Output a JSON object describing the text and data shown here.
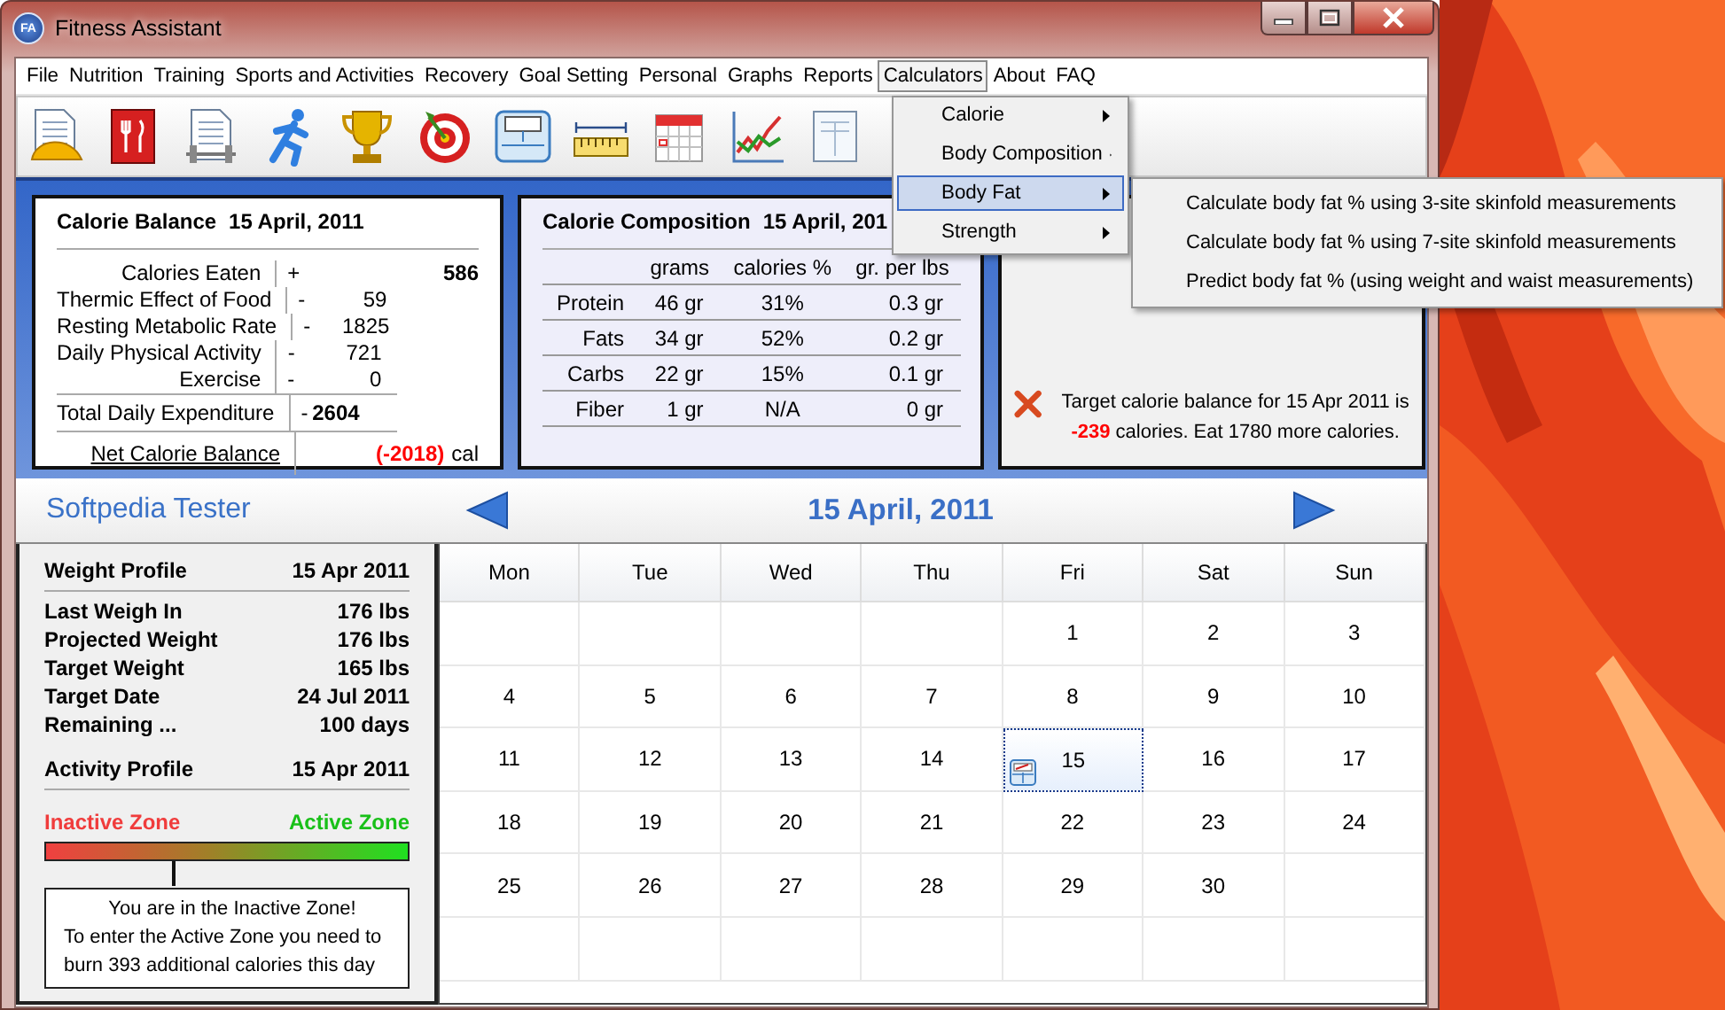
{
  "window": {
    "title": "Fitness Assistant",
    "app_icon": "FA"
  },
  "menu_bar": [
    {
      "label": "File",
      "open": false
    },
    {
      "label": "Nutrition",
      "open": false
    },
    {
      "label": "Training",
      "open": false
    },
    {
      "label": "Sports and Activities",
      "open": false
    },
    {
      "label": "Recovery",
      "open": false
    },
    {
      "label": "Goal Setting",
      "open": false
    },
    {
      "label": "Personal",
      "open": false
    },
    {
      "label": "Graphs",
      "open": false
    },
    {
      "label": "Reports",
      "open": false
    },
    {
      "label": "Calculators",
      "open": true
    },
    {
      "label": "About",
      "open": false
    },
    {
      "label": "FAQ",
      "open": false
    }
  ],
  "calculators_menu": {
    "items": [
      {
        "label": "Calorie",
        "selected": false
      },
      {
        "label": "Body Composition",
        "selected": false
      },
      {
        "label": "Body Fat",
        "selected": true
      },
      {
        "label": "Strength",
        "selected": false
      }
    ],
    "submenu": [
      "Calculate body fat % using 3-site skinfold measurements",
      "Calculate body fat % using 7-site skinfold measurements",
      "Predict body fat % (using weight and waist measurements)"
    ]
  },
  "calorie_balance": {
    "title": "Calorie Balance",
    "date": "15 April, 2011",
    "rows": [
      {
        "kind": "intake",
        "label": "Calories Eaten",
        "sign": "+",
        "value": "586"
      },
      {
        "kind": "expense",
        "label": "Thermic Effect of Food",
        "sign": "-",
        "value": "59"
      },
      {
        "kind": "expense",
        "label": "Resting Metabolic Rate",
        "sign": "-",
        "value": "1825"
      },
      {
        "kind": "expense",
        "label": "Daily Physical Activity",
        "sign": "-",
        "value": "721"
      },
      {
        "kind": "expense",
        "label": "Exercise",
        "sign": "-",
        "value": "0"
      },
      {
        "kind": "total",
        "label": "Total Daily Expenditure",
        "sign": "-",
        "value": "2604"
      }
    ],
    "net": {
      "label": "Net Calorie Balance",
      "value": "(-2018)",
      "unit": "cal"
    }
  },
  "calorie_composition": {
    "title": "Calorie Composition",
    "date": "15 April, 201",
    "columns": [
      "grams",
      "calories %",
      "gr. per lbs"
    ],
    "rows": [
      {
        "name": "Protein",
        "cells": [
          "46 gr",
          "31%",
          "0.3 gr"
        ]
      },
      {
        "name": "Fats",
        "cells": [
          "34 gr",
          "52%",
          "0.2 gr"
        ]
      },
      {
        "name": "Carbs",
        "cells": [
          "22 gr",
          "15%",
          "0.1 gr"
        ]
      },
      {
        "name": "Fiber",
        "cells": [
          "1 gr",
          "N/A",
          "0 gr"
        ]
      }
    ]
  },
  "target": {
    "met": false,
    "message": "Target calorie balance for 15 Apr 2011 is **-239** calories. Eat 1780 more calories."
  },
  "user": {
    "name": "Softpedia Tester"
  },
  "date_nav": {
    "date": "15 April, 2011"
  },
  "profile": {
    "weight_header": {
      "label": "Weight Profile",
      "date": "15 Apr 2011"
    },
    "weight_rows": [
      {
        "label": "Last Weigh In",
        "value": "176 lbs"
      },
      {
        "label": "Projected Weight",
        "value": "176 lbs"
      },
      {
        "label": "Target Weight",
        "value": "165 lbs"
      },
      {
        "label": "Target Date",
        "value": "24 Jul 2011"
      },
      {
        "label": "Remaining ...",
        "value": "100 days"
      }
    ],
    "activity_header": {
      "label": "Activity Profile",
      "date": "15 Apr 2011"
    },
    "zone": {
      "inactive_label": "Inactive Zone",
      "active_label": "Active Zone",
      "level": 0.35,
      "message": [
        "You are in the Inactive Zone!",
        "To enter the Active Zone you need to",
        "burn 393 additional calories this day"
      ]
    }
  },
  "calendar": {
    "weekdays": [
      "Mon",
      "Tue",
      "Wed",
      "Thu",
      "Fri",
      "Sat",
      "Sun"
    ],
    "weeks": [
      {
        "right_aligned": true,
        "days": [
          {
            "label": "1",
            "selected": false,
            "weigh_in": false
          },
          {
            "label": "2",
            "selected": false,
            "weigh_in": false
          },
          {
            "label": "3",
            "selected": false,
            "weigh_in": false
          }
        ]
      },
      {
        "right_aligned": false,
        "days": [
          {
            "label": "4",
            "selected": false,
            "weigh_in": false
          },
          {
            "label": "5",
            "selected": false,
            "weigh_in": false
          },
          {
            "label": "6",
            "selected": false,
            "weigh_in": false
          },
          {
            "label": "7",
            "selected": false,
            "weigh_in": false
          },
          {
            "label": "8",
            "selected": false,
            "weigh_in": false
          },
          {
            "label": "9",
            "selected": false,
            "weigh_in": false
          },
          {
            "label": "10",
            "selected": false,
            "weigh_in": false
          }
        ]
      },
      {
        "right_aligned": false,
        "days": [
          {
            "label": "11",
            "selected": false,
            "weigh_in": false
          },
          {
            "label": "12",
            "selected": false,
            "weigh_in": false
          },
          {
            "label": "13",
            "selected": false,
            "weigh_in": false
          },
          {
            "label": "14",
            "selected": false,
            "weigh_in": false
          },
          {
            "label": "15",
            "selected": true,
            "weigh_in": true
          },
          {
            "label": "16",
            "selected": false,
            "weigh_in": false
          },
          {
            "label": "17",
            "selected": false,
            "weigh_in": false
          }
        ]
      },
      {
        "right_aligned": false,
        "days": [
          {
            "label": "18",
            "selected": false,
            "weigh_in": false
          },
          {
            "label": "19",
            "selected": false,
            "weigh_in": false
          },
          {
            "label": "20",
            "selected": false,
            "weigh_in": false
          },
          {
            "label": "21",
            "selected": false,
            "weigh_in": false
          },
          {
            "label": "22",
            "selected": false,
            "weigh_in": false
          },
          {
            "label": "23",
            "selected": false,
            "weigh_in": false
          },
          {
            "label": "24",
            "selected": false,
            "weigh_in": false
          }
        ]
      },
      {
        "right_aligned": false,
        "days": [
          {
            "label": "25",
            "selected": false,
            "weigh_in": false
          },
          {
            "label": "26",
            "selected": false,
            "weigh_in": false
          },
          {
            "label": "27",
            "selected": false,
            "weigh_in": false
          },
          {
            "label": "28",
            "selected": false,
            "weigh_in": false
          },
          {
            "label": "29",
            "selected": false,
            "weigh_in": false
          },
          {
            "label": "30",
            "selected": false,
            "weigh_in": false
          }
        ]
      }
    ]
  }
}
